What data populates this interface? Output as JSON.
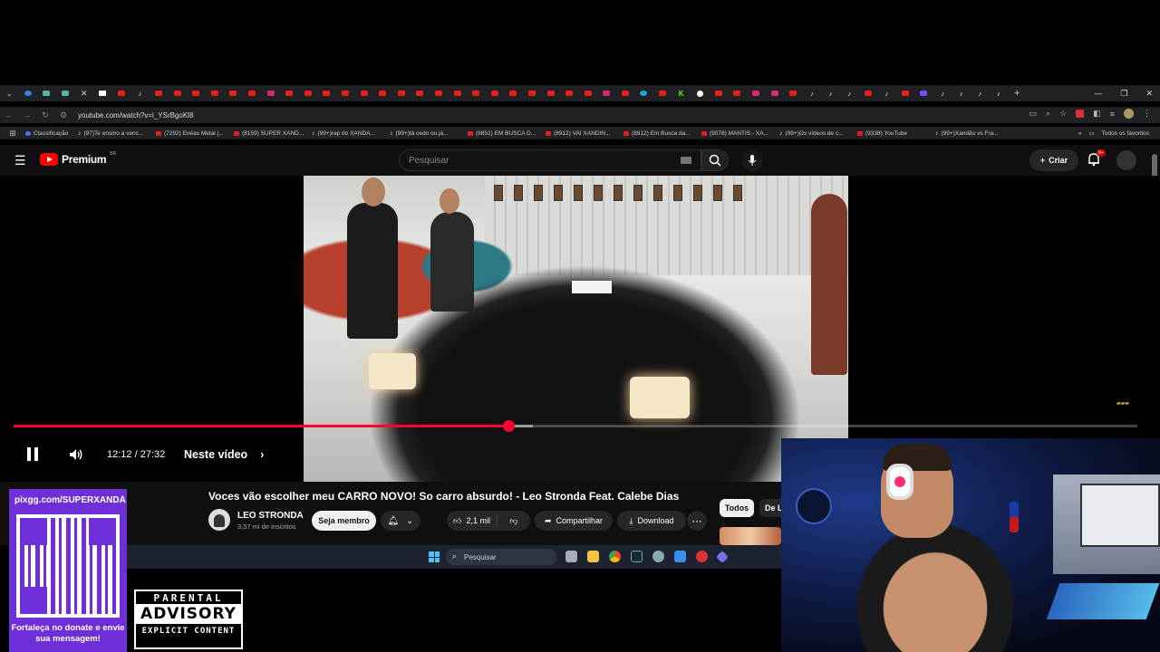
{
  "browser": {
    "url": "youtube.com/watch?v=i_YSrBgoKl8",
    "bookmarks": [
      {
        "label": "Classificação",
        "icon": "circle"
      },
      {
        "label": "(97)Te ensino a venc...",
        "icon": "tiktok"
      },
      {
        "label": "(7292) Enéas Metal |...",
        "icon": "youtube"
      },
      {
        "label": "(8159) SUPER XAND...",
        "icon": "youtube"
      },
      {
        "label": "(99+)rap do XANDÃ...",
        "icon": "tiktok"
      },
      {
        "label": "(99+)tá cedo ou já...",
        "icon": "tiktok"
      },
      {
        "label": "(8851) EM BUSCA D...",
        "icon": "youtube"
      },
      {
        "label": "(8912) VAI XANDIN...",
        "icon": "youtube"
      },
      {
        "label": "(8912) Em Busca da...",
        "icon": "youtube"
      },
      {
        "label": "(9078) MANTIS - XA...",
        "icon": "youtube"
      },
      {
        "label": "(99+)Os vídeos de c...",
        "icon": "tiktok"
      },
      {
        "label": "(9338) YouTube",
        "icon": "youtube"
      },
      {
        "label": "(99+)Xandão vs Fra...",
        "icon": "tiktok"
      }
    ],
    "bookmarks_all": "Todos os favoritos",
    "tab_icons": [
      "chevron",
      "dg",
      "gn",
      "gn",
      "x",
      "act",
      "yt",
      "tt",
      "yt",
      "yt",
      "yt",
      "yt",
      "yt",
      "yt",
      "ig",
      "yt",
      "yt",
      "yt",
      "yt",
      "yt",
      "yt",
      "yt",
      "yt",
      "yt",
      "yt",
      "yt",
      "yt",
      "yt",
      "yt",
      "yt",
      "yt",
      "yt",
      "ig",
      "yt",
      "tg",
      "yt",
      "k",
      "g",
      "yt",
      "yt",
      "ig",
      "ig",
      "yt",
      "tt",
      "tt",
      "tt",
      "yt",
      "tt",
      "yt",
      "m",
      "tt",
      "tt",
      "tt",
      "tt",
      "plus"
    ]
  },
  "youtube": {
    "logo_text": "Premium",
    "logo_region": "BR",
    "search_placeholder": "Pesquisar",
    "create_label": "Criar",
    "notif_badge": "9+"
  },
  "player": {
    "time": "12:12 / 27:32",
    "chapters_label": "Neste vídeo",
    "progress": 0.44,
    "buffered": 0.462
  },
  "video": {
    "title": "Voces vão escolher meu CARRO NOVO! So carro absurdo! - Leo Stronda Feat. Calebe Dias",
    "channel": "LEO STRONDA",
    "subscribers": "3,57 mi de inscritos",
    "member_button": "Seja membro",
    "likes": "2,1 mil",
    "share": "Compartilhar",
    "download": "Download"
  },
  "chips": {
    "all": "Todos",
    "other": "De L"
  },
  "taskbar": {
    "search": "Pesquisar"
  },
  "overlay": {
    "qr_url": "pixgg.com/SUPERXANDÃ",
    "qr_text": "Fortaleça no donate e envie sua mensagem!",
    "advisory_top": "PARENTAL",
    "advisory_mid": "ADVISORY",
    "advisory_bottom": "EXPLICIT CONTENT"
  },
  "colors": {
    "youtube_red": "#ff0000",
    "progress_red": "#ff0033",
    "qr_purple": "#6f2fd8",
    "taskbar": "#1c2230"
  }
}
